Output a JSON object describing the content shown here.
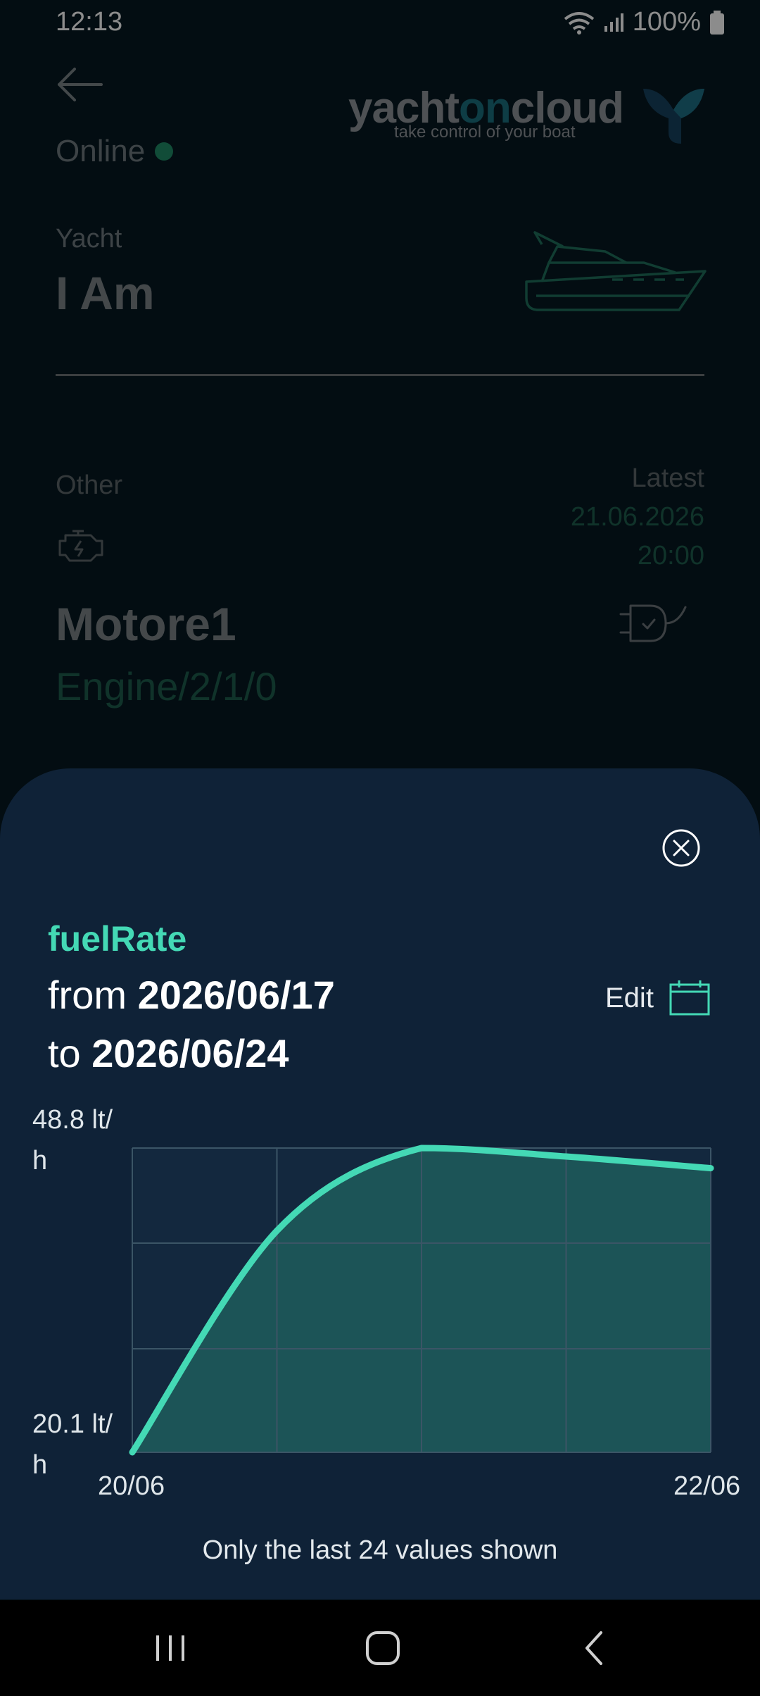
{
  "status_bar": {
    "time": "12:13",
    "battery": "100%"
  },
  "header": {
    "status_label": "Online",
    "status_color": "#1f8a66"
  },
  "logo": {
    "brand_prefix": "yacht",
    "brand_mid": "on",
    "brand_suffix": "cloud",
    "tagline": "take control of your boat"
  },
  "yacht": {
    "label": "Yacht",
    "name": "I Am"
  },
  "device": {
    "category": "Other",
    "latest_label": "Latest",
    "latest_date": "21.06.2026",
    "latest_time": "20:00",
    "name": "Motore1",
    "path": "Engine/2/1/0"
  },
  "sheet": {
    "metric": "fuelRate",
    "from_prefix": "from",
    "from_date": "2026/06/17",
    "to_prefix": "to",
    "to_date": "2026/06/24",
    "edit_label": "Edit",
    "footnote": "Only the last 24 values shown"
  },
  "chart_data": {
    "type": "area",
    "x": [
      "20/06",
      "",
      "",
      "",
      "22/06"
    ],
    "values": [
      20.1,
      41.0,
      48.8,
      48.0,
      46.9
    ],
    "ylim": [
      20.1,
      48.8
    ],
    "y_tick_labels": [
      "48.8 lt/\nh",
      "20.1 lt/\nh"
    ],
    "x_tick_labels": [
      "20/06",
      "22/06"
    ],
    "grid": true,
    "line_color": "#44d9b5",
    "fill_color": "#1f5c5c"
  }
}
